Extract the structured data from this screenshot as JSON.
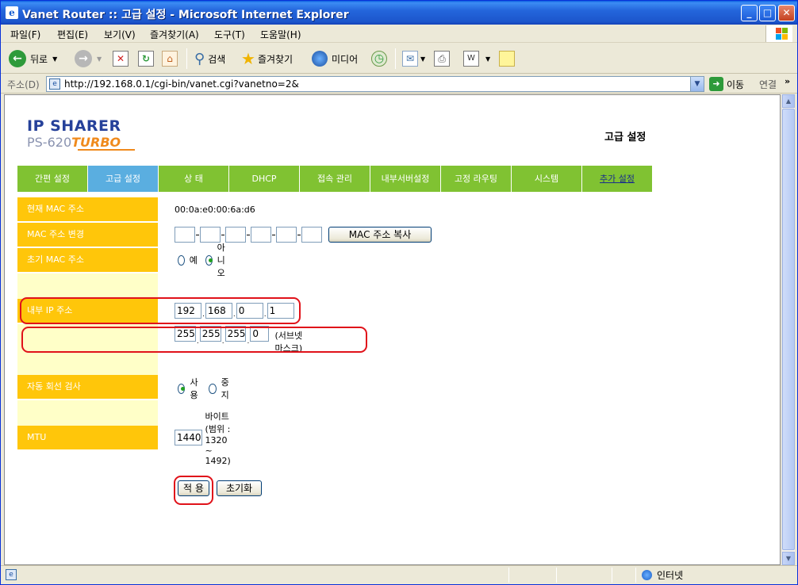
{
  "window": {
    "title": "Vanet Router :: 고급 설정 - Microsoft Internet Explorer",
    "minimize": "_",
    "maximize": "□",
    "close": "✕"
  },
  "menu": [
    "파일(F)",
    "편집(E)",
    "보기(V)",
    "즐겨찾기(A)",
    "도구(T)",
    "도움말(H)"
  ],
  "toolbar": {
    "back": "뒤로",
    "search": "검색",
    "favorites": "즐겨찾기",
    "media": "미디어"
  },
  "address": {
    "label": "주소(D)",
    "url": "http://192.168.0.1/cgi-bin/vanet.cgi?vanetno=2&",
    "go": "이동",
    "links": "연결"
  },
  "page": {
    "logo_line1": "IP SHARER",
    "logo_model": "PS-620",
    "logo_turbo": "TURBO",
    "title": "고급 설정"
  },
  "nav": [
    {
      "label": "간편 설정",
      "state": "normal"
    },
    {
      "label": "고급 설정",
      "state": "active"
    },
    {
      "label": "상 태",
      "state": "normal"
    },
    {
      "label": "DHCP",
      "state": "normal"
    },
    {
      "label": "접속 관리",
      "state": "normal"
    },
    {
      "label": "내부서버설정",
      "state": "normal"
    },
    {
      "label": "고정 라우팅",
      "state": "normal"
    },
    {
      "label": "시스템",
      "state": "normal"
    },
    {
      "label": "추가 설정",
      "state": "link"
    }
  ],
  "form": {
    "current_mac_label": "현재 MAC 주소",
    "current_mac_value": "00:0a:e0:00:6a:d6",
    "mac_change_label": "MAC 주소 변경",
    "mac_fields": [
      "",
      "",
      "",
      "",
      "",
      ""
    ],
    "mac_copy_button": "MAC 주소 복사",
    "initial_mac_label": "초기 MAC 주소",
    "initial_mac_yes": "예",
    "initial_mac_no": "아니오",
    "initial_mac_selected": "no",
    "internal_ip_label": "내부 IP 주소",
    "ip": [
      "192",
      "168",
      "0",
      "1"
    ],
    "subnet": [
      "255",
      "255",
      "255",
      "0"
    ],
    "subnet_note": "(서브넷 마스크)",
    "auto_line_label": "자동 회선 검사",
    "auto_line_on": "사용",
    "auto_line_off": "중지",
    "auto_line_selected": "on",
    "mtu_label": "MTU",
    "mtu_value": "1440",
    "mtu_note": "바이트 (범위 : 1320 ~ 1492)",
    "apply_button": "적 용",
    "reset_button": "초기화"
  },
  "status": {
    "zone": "인터넷"
  },
  "colors": {
    "nav_green": "#80c232",
    "nav_active": "#5aaee0",
    "label_yellow": "#ffc60a",
    "highlight_red": "#e0121a"
  }
}
